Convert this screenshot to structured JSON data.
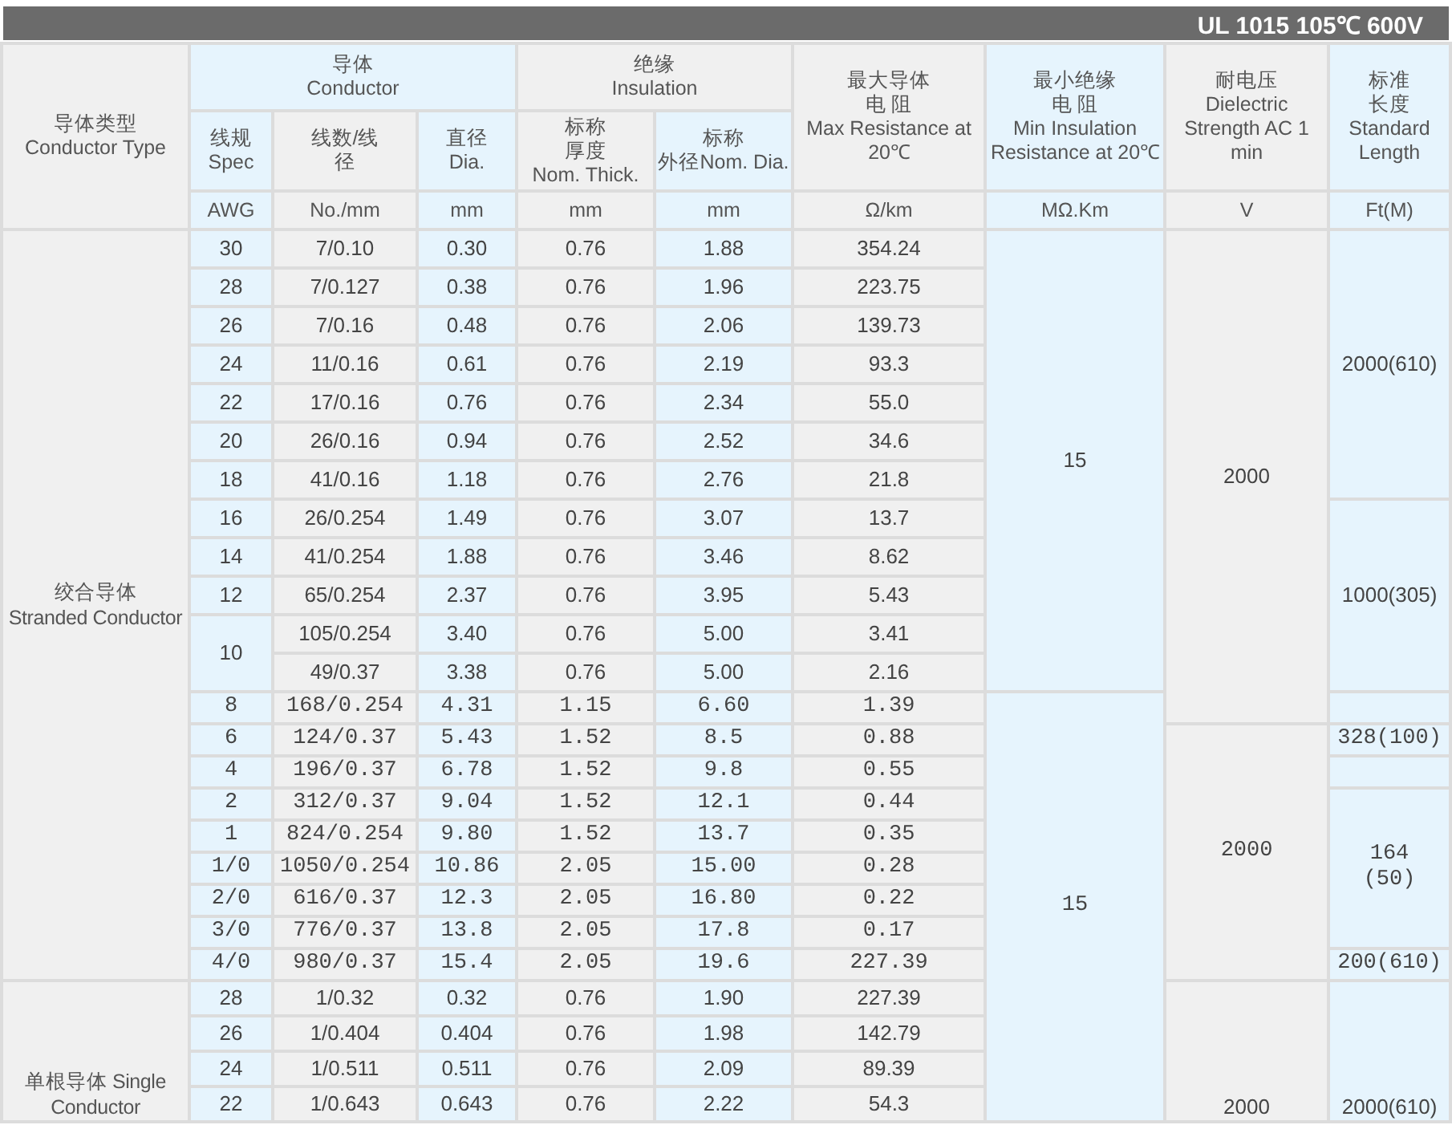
{
  "title": "UL 1015 105℃ 600V",
  "header": {
    "conductor_type": {
      "zh": "导体类型",
      "en": "Conductor Type"
    },
    "conductor": {
      "label": {
        "zh": "导体",
        "en": "Conductor"
      },
      "columns": [
        {
          "label": {
            "zh": "线规",
            "en": "Spec"
          },
          "unit": "AWG"
        },
        {
          "label": {
            "zh": "线数/线径"
          },
          "unit": "No./mm"
        },
        {
          "label": {
            "zh": "直径",
            "en": "Dia."
          },
          "unit": "mm"
        }
      ]
    },
    "insulation": {
      "label": {
        "zh": "绝缘",
        "en": "Insulation"
      },
      "columns": [
        {
          "label": {
            "zh": "标称厚度",
            "en": "Nom. Thick."
          },
          "unit": "mm"
        },
        {
          "label": {
            "zh": "标称",
            "en": "外径Nom. Dia."
          },
          "unit": "mm"
        }
      ]
    },
    "max_resistance": {
      "label": {
        "zh": "最大导体电 阻",
        "en": "Max Resistance at\n20℃"
      },
      "unit": "Ω/km"
    },
    "min_insulation": {
      "label": {
        "zh": "最小绝缘电 阻",
        "en": "Min Insulation\nResistance at 20℃"
      },
      "unit": "MΩ.Km"
    },
    "dielectric": {
      "label": {
        "zh": "耐电压",
        "en": "Dielectric\nStrength AC 1\nmin"
      },
      "unit": "V"
    },
    "length": {
      "label": {
        "zh": "标准长度",
        "en": "Standard\nLength"
      },
      "unit": "Ft(M)"
    }
  },
  "sections": [
    {
      "label": "绞合导体\nStranded Conductor",
      "rows": [
        {
          "kind": "standard",
          "spec": "30",
          "strands": "7/0.10",
          "dia": "0.30",
          "thickness": "0.76",
          "outer_dia": "1.88",
          "resistance": "354.24",
          "insulation": "15",
          "voltage": "2000",
          "length": "2000(610)"
        },
        {
          "kind": "standard",
          "spec": "28",
          "strands": "7/0.127",
          "dia": "0.38",
          "thickness": "0.76",
          "outer_dia": "1.96",
          "resistance": "223.75",
          "insulation": null,
          "voltage": null,
          "length": null
        },
        {
          "kind": "standard",
          "spec": "26",
          "strands": "7/0.16",
          "dia": "0.48",
          "thickness": "0.76",
          "outer_dia": "2.06",
          "resistance": "139.73",
          "insulation": null,
          "voltage": null,
          "length": null
        },
        {
          "kind": "standard",
          "spec": "24",
          "strands": "11/0.16",
          "dia": "0.61",
          "thickness": "0.76",
          "outer_dia": "2.19",
          "resistance": "93.3",
          "insulation": null,
          "voltage": null,
          "length": null
        },
        {
          "kind": "standard",
          "spec": "22",
          "strands": "17/0.16",
          "dia": "0.76",
          "thickness": "0.76",
          "outer_dia": "2.34",
          "resistance": "55.0",
          "insulation": null,
          "voltage": null,
          "length": null
        },
        {
          "kind": "standard",
          "spec": "20",
          "strands": "26/0.16",
          "dia": "0.94",
          "thickness": "0.76",
          "outer_dia": "2.52",
          "resistance": "34.6",
          "insulation": null,
          "voltage": null,
          "length": null
        },
        {
          "kind": "standard",
          "spec": "18",
          "strands": "41/0.16",
          "dia": "1.18",
          "thickness": "0.76",
          "outer_dia": "2.76",
          "resistance": "21.8",
          "insulation": null,
          "voltage": null,
          "length": null
        },
        {
          "kind": "standard",
          "spec": "16",
          "strands": "26/0.254",
          "dia": "1.49",
          "thickness": "0.76",
          "outer_dia": "3.07",
          "resistance": "13.7",
          "insulation": null,
          "voltage": null,
          "length": "1000(305)"
        },
        {
          "kind": "standard",
          "spec": "14",
          "strands": "41/0.254",
          "dia": "1.88",
          "thickness": "0.76",
          "outer_dia": "3.46",
          "resistance": "8.62",
          "insulation": null,
          "voltage": null,
          "length": null
        },
        {
          "kind": "standard",
          "spec": "12",
          "strands": "65/0.254",
          "dia": "2.37",
          "thickness": "0.76",
          "outer_dia": "3.95",
          "resistance": "5.43",
          "insulation": null,
          "voltage": null,
          "length": null
        },
        {
          "kind": "standard",
          "spec": "10",
          "strands": "105/0.254",
          "dia": "3.40",
          "thickness": "0.76",
          "outer_dia": "5.00",
          "resistance": "3.41",
          "insulation": null,
          "voltage": null,
          "length": null
        },
        {
          "kind": "standard",
          "spec": null,
          "strands": "49/0.37",
          "dia": "3.38",
          "thickness": "0.76",
          "outer_dia": "5.00",
          "resistance": "2.16",
          "insulation": null,
          "voltage": null,
          "length": null
        },
        {
          "kind": "compact",
          "spec": "8",
          "strands": "168/0.254",
          "dia": "4.31",
          "thickness": "1.15",
          "outer_dia": "6.60",
          "resistance": "1.39",
          "insulation": "15",
          "voltage": null
        },
        {
          "kind": "compact",
          "spec": "6",
          "strands": "124/0.37",
          "dia": "5.43",
          "thickness": "1.52",
          "outer_dia": "8.5",
          "resistance": "0.88",
          "insulation": null,
          "voltage": "2000",
          "length": "328(100)"
        },
        {
          "kind": "compact",
          "spec": "4",
          "strands": "196/0.37",
          "dia": "6.78",
          "thickness": "1.52",
          "outer_dia": "9.8",
          "resistance": "0.55",
          "insulation": null,
          "voltage": null
        },
        {
          "kind": "compact",
          "spec": "2",
          "strands": "312/0.37",
          "dia": "9.04",
          "thickness": "1.52",
          "outer_dia": "12.1",
          "resistance": "0.44",
          "insulation": null,
          "voltage": null,
          "length": "164\n(50)"
        },
        {
          "kind": "compact",
          "spec": "1",
          "strands": "824/0.254",
          "dia": "9.80",
          "thickness": "1.52",
          "outer_dia": "13.7",
          "resistance": "0.35",
          "insulation": null,
          "voltage": null,
          "length": null
        },
        {
          "kind": "compact",
          "spec": "1/0",
          "strands": "1050/0.254",
          "dia": "10.86",
          "thickness": "2.05",
          "outer_dia": "15.00",
          "resistance": "0.28",
          "insulation": null,
          "voltage": null,
          "length": null
        },
        {
          "kind": "compact",
          "spec": "2/0",
          "strands": "616/0.37",
          "dia": "12.3",
          "thickness": "2.05",
          "outer_dia": "16.80",
          "resistance": "0.22",
          "insulation": null,
          "voltage": null,
          "length": null
        },
        {
          "kind": "compact",
          "spec": "3/0",
          "strands": "776/0.37",
          "dia": "13.8",
          "thickness": "2.05",
          "outer_dia": "17.8",
          "resistance": "0.17",
          "insulation": null,
          "voltage": null,
          "length": null
        },
        {
          "kind": "compact",
          "spec": "4/0",
          "strands": "980/0.37",
          "dia": "15.4",
          "thickness": "2.05",
          "outer_dia": "19.6",
          "resistance": "227.39",
          "insulation": null,
          "voltage": null,
          "length": "200(610)"
        }
      ]
    },
    {
      "label": "单根导体  Single\nConductor",
      "rows": [
        {
          "kind": "single",
          "spec": "28",
          "strands": "1/0.32",
          "dia": "0.32",
          "thickness": "0.76",
          "outer_dia": "1.90",
          "resistance": "227.39",
          "insulation": null,
          "voltage": "2000",
          "length": "2000(610)"
        },
        {
          "kind": "single",
          "spec": "26",
          "strands": "1/0.404",
          "dia": "0.404",
          "thickness": "0.76",
          "outer_dia": "1.98",
          "resistance": "142.79",
          "insulation": null,
          "voltage": null,
          "length": null
        },
        {
          "kind": "single",
          "spec": "24",
          "strands": "1/0.511",
          "dia": "0.511",
          "thickness": "0.76",
          "outer_dia": "2.09",
          "resistance": "89.39",
          "insulation": null,
          "voltage": null,
          "length": null
        },
        {
          "kind": "single",
          "spec": "22",
          "strands": "1/0.643",
          "dia": "0.643",
          "thickness": "0.76",
          "outer_dia": "2.22",
          "resistance": "54.3",
          "insulation": null,
          "voltage": null,
          "length": null
        }
      ]
    }
  ]
}
